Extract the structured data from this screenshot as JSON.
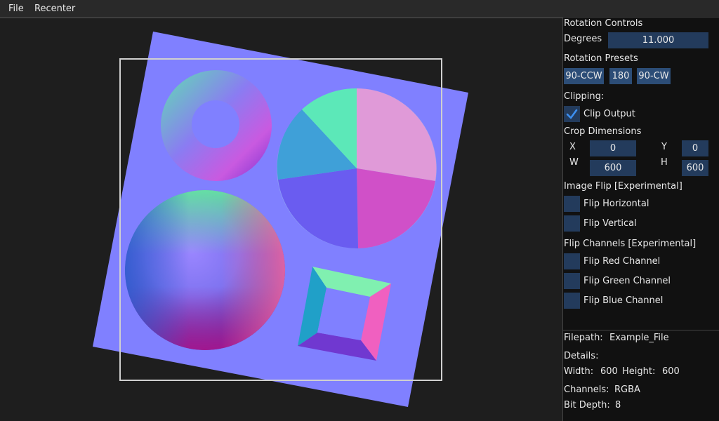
{
  "menu": {
    "file": "File",
    "recenter": "Recenter"
  },
  "panel": {
    "rotation_controls": "Rotation Controls",
    "degrees_label": "Degrees",
    "degrees_value": "11.000",
    "rotation_presets": "Rotation Presets",
    "presets": [
      "90-CCW",
      "180",
      "90-CW"
    ],
    "clipping": "Clipping:",
    "clip_output": {
      "label": "Clip Output",
      "checked": true
    },
    "crop_dimensions": "Crop Dimensions",
    "crop": {
      "x_label": "X",
      "x": "0",
      "y_label": "Y",
      "y": "0",
      "w_label": "W",
      "w": "600",
      "h_label": "H",
      "h": "600"
    },
    "image_flip": "Image Flip [Experimental]",
    "flip_horizontal": {
      "label": "Flip Horizontal",
      "checked": false
    },
    "flip_vertical": {
      "label": "Flip Vertical",
      "checked": false
    },
    "flip_channels": "Flip Channels [Experimental]",
    "flip_red": {
      "label": "Flip Red Channel",
      "checked": false
    },
    "flip_green": {
      "label": "Flip Green Channel",
      "checked": false
    },
    "flip_blue": {
      "label": "Flip Blue Channel",
      "checked": false
    }
  },
  "info": {
    "filepath_label": "Filepath:",
    "filepath": "Example_File",
    "details_label": "Details:",
    "width_label": "Width:",
    "width": "600",
    "height_label": "Height:",
    "height": "600",
    "channels_label": "Channels:",
    "channels": "RGBA",
    "bitdepth_label": "Bit Depth:",
    "bitdepth": "8"
  },
  "colors": {
    "accent_check": "#3d8ff0",
    "field_bg": "#233b5c",
    "button_bg": "#2c4d77",
    "normal_map_base": "#8080ff"
  }
}
